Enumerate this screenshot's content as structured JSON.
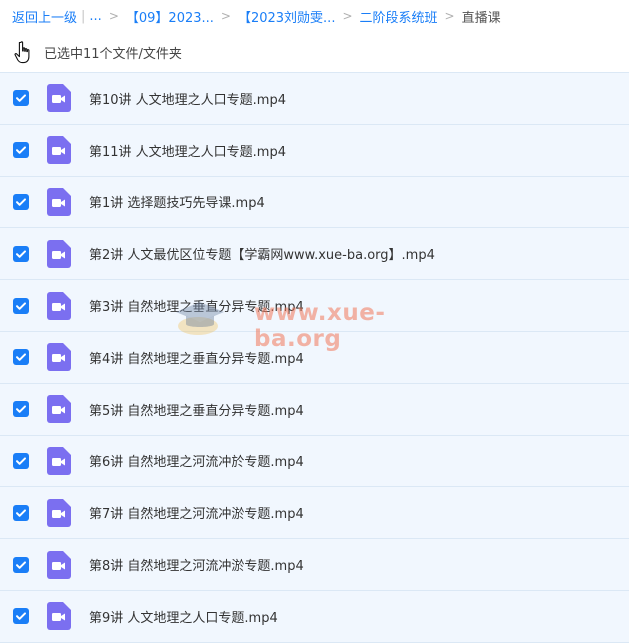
{
  "breadcrumb": {
    "back": "返回上一级",
    "ellipsis": "...",
    "crumb1": "【09】2023...",
    "crumb2": "【2023刘勋雯...",
    "crumb3": "二阶段系统班",
    "current": "直播课"
  },
  "selection": {
    "summary": "已选中11个文件/文件夹"
  },
  "files": [
    {
      "name": "第10讲 人文地理之人口专题.mp4",
      "checked": true
    },
    {
      "name": "第11讲 人文地理之人口专题.mp4",
      "checked": true
    },
    {
      "name": "第1讲 选择题技巧先导课.mp4",
      "checked": true
    },
    {
      "name": "第2讲 人文最优区位专题【学霸网www.xue-ba.org】.mp4",
      "checked": true
    },
    {
      "name": "第3讲 自然地理之垂直分异专题.mp4",
      "checked": true
    },
    {
      "name": "第4讲 自然地理之垂直分异专题.mp4",
      "checked": true
    },
    {
      "name": "第5讲 自然地理之垂直分异专题.mp4",
      "checked": true
    },
    {
      "name": "第6讲 自然地理之河流冲於专题.mp4",
      "checked": true
    },
    {
      "name": "第7讲 自然地理之河流冲淤专题.mp4",
      "checked": true
    },
    {
      "name": "第8讲 自然地理之河流冲淤专题.mp4",
      "checked": true
    },
    {
      "name": "第9讲 人文地理之人口专题.mp4",
      "checked": true
    }
  ],
  "watermark": {
    "text": "www.xue-ba.org"
  },
  "colors": {
    "accent": "#1a7ef7",
    "row_bg": "#f1f7fe",
    "video_icon": "#7b6ff0"
  },
  "icons": {
    "checkbox": "check-icon",
    "file": "video-file-icon",
    "cursor": "hand-pointer-icon"
  }
}
